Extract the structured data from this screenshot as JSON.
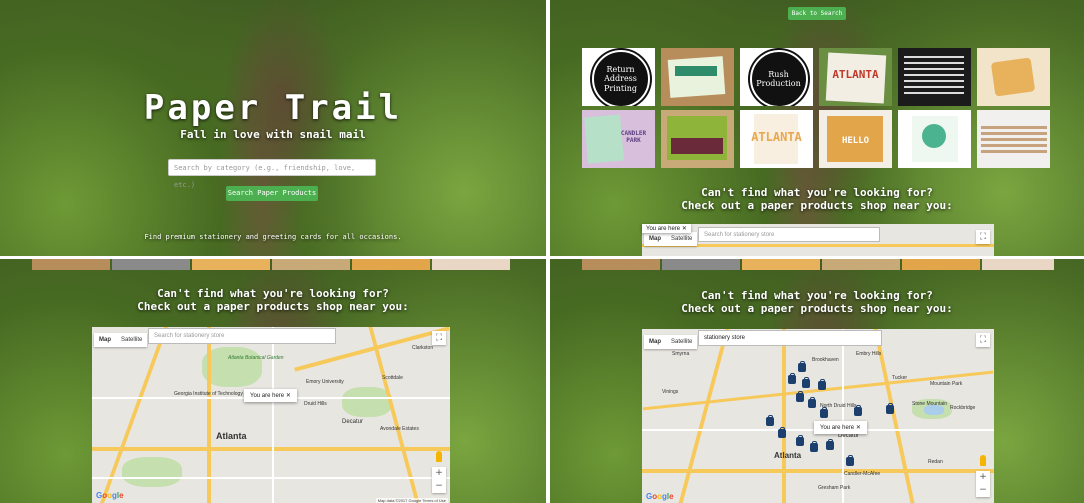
{
  "panel1": {
    "title": "Paper Trail",
    "subtitle": "Fall in love with snail mail",
    "search_placeholder": "Search by category (e.g., friendship, love, etc.)",
    "search_button": "Search Paper Products",
    "tagline": "Find premium stationery and greeting cards for all occasions."
  },
  "panel2": {
    "back_button": "Back to Search",
    "tiles": [
      {
        "type": "circle",
        "text": "Return Address Printing"
      },
      {
        "type": "card",
        "text": "",
        "color": "#2f8c6a"
      },
      {
        "type": "circle",
        "text": "Rush Production"
      },
      {
        "type": "card",
        "text": "ATLANTA",
        "color": "#c0392b"
      },
      {
        "type": "card",
        "text": "",
        "color": "#222222"
      },
      {
        "type": "card",
        "text": "",
        "color": "#e8c27a"
      },
      {
        "type": "card",
        "text": "CANDLER PARK",
        "color": "#b7e0c8"
      },
      {
        "type": "card",
        "text": "",
        "color": "#8fb43a"
      },
      {
        "type": "card",
        "text": "ATLANTA",
        "color": "#f3c785"
      },
      {
        "type": "card",
        "text": "HELLO",
        "color": "#e2a54a"
      },
      {
        "type": "card",
        "text": "",
        "color": "#4bb38f"
      },
      {
        "type": "card",
        "text": "",
        "color": "#e9d6c4"
      }
    ],
    "cant_find_1": "Can't find what you're looking for?",
    "cant_find_2": "Check out a paper products shop near you:",
    "map": {
      "type_map": "Map",
      "type_satellite": "Satellite",
      "search_placeholder": "Search for stationery store",
      "you_are_here": "You are here"
    }
  },
  "panel3": {
    "cant_find_1": "Can't find what you're looking for?",
    "cant_find_2": "Check out a paper products shop near you:",
    "map": {
      "type_map": "Map",
      "type_satellite": "Satellite",
      "search_placeholder": "Search for stationery store",
      "you_are_here": "You are here",
      "labels": [
        "Atlanta Botanical Garden",
        "Emory University",
        "Georgia Institute of Technology",
        "Atlanta",
        "Decatur",
        "Avondale Estates",
        "Scottdale",
        "Clarkston",
        "Druid Hills"
      ],
      "footer": "Map data ©2017 Google  Terms of Use"
    }
  },
  "panel4": {
    "cant_find_1": "Can't find what you're looking for?",
    "cant_find_2": "Check out a paper products shop near you:",
    "map": {
      "type_map": "Map",
      "type_satellite": "Satellite",
      "search_value": "stationery store",
      "you_are_here": "You are here",
      "labels": [
        "Smyrna",
        "Brookhaven",
        "Embry Hills",
        "Tucker",
        "Mountain Park",
        "Stone Mountain",
        "Rockbridge",
        "North Druid Hills",
        "Decatur",
        "Atlanta",
        "Redan",
        "Candler-McAfee",
        "Gresham Park",
        "Vinings"
      ]
    }
  },
  "google_logo": "Google",
  "colors": {
    "accent_green": "#4caf50",
    "pin_navy": "#1c3f6e"
  }
}
